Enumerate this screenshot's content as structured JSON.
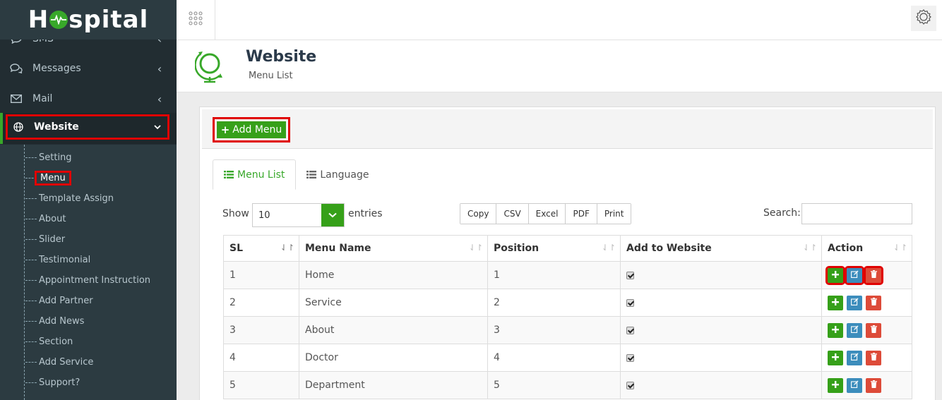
{
  "app": {
    "logo_text_left": "H",
    "logo_text_right": "spital"
  },
  "sidebar": {
    "items": [
      {
        "label": "SMS",
        "icon": "comment-icon"
      },
      {
        "label": "Messages",
        "icon": "comments-icon"
      },
      {
        "label": "Mail",
        "icon": "envelope-icon"
      },
      {
        "label": "Website",
        "icon": "globe-icon"
      }
    ],
    "submenu": [
      {
        "label": "Setting"
      },
      {
        "label": "Menu"
      },
      {
        "label": "Template Assign"
      },
      {
        "label": "About"
      },
      {
        "label": "Slider"
      },
      {
        "label": "Testimonial"
      },
      {
        "label": "Appointment Instruction"
      },
      {
        "label": "Add Partner"
      },
      {
        "label": "Add News"
      },
      {
        "label": "Section"
      },
      {
        "label": "Add Service"
      },
      {
        "label": "Support?"
      }
    ]
  },
  "header": {
    "title": "Website",
    "subtitle": "Menu List"
  },
  "panel": {
    "add_button": "Add Menu",
    "tabs": [
      {
        "label": "Menu List"
      },
      {
        "label": "Language"
      }
    ]
  },
  "table_controls": {
    "show_label": "Show",
    "entries_value": "10",
    "entries_label": "entries",
    "export_buttons": [
      "Copy",
      "CSV",
      "Excel",
      "PDF",
      "Print"
    ],
    "search_label": "Search:",
    "search_value": ""
  },
  "table": {
    "columns": [
      "SL",
      "Menu Name",
      "Position",
      "Add to Website",
      "Action"
    ],
    "rows": [
      {
        "sl": "1",
        "name": "Home",
        "position": "1",
        "on_website": true
      },
      {
        "sl": "2",
        "name": "Service",
        "position": "2",
        "on_website": true
      },
      {
        "sl": "3",
        "name": "About",
        "position": "3",
        "on_website": true
      },
      {
        "sl": "4",
        "name": "Doctor",
        "position": "4",
        "on_website": true
      },
      {
        "sl": "5",
        "name": "Department",
        "position": "5",
        "on_website": true
      }
    ]
  },
  "colors": {
    "accent": "#38a82a",
    "highlight": "#e00000",
    "sidebar": "#222d32",
    "edit": "#3c8dbc",
    "delete": "#dd4b39"
  }
}
